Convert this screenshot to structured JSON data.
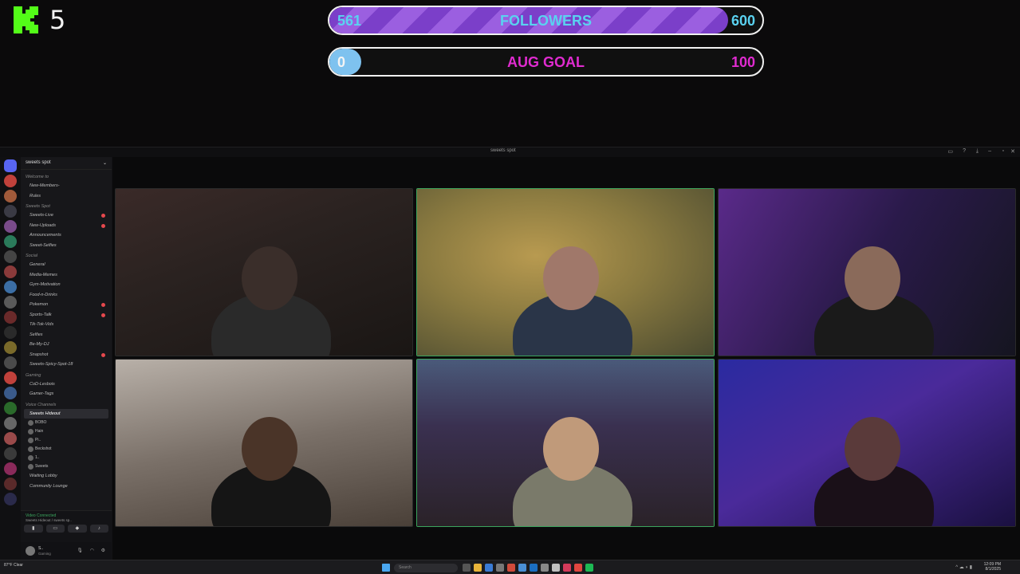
{
  "overlay": {
    "kick_count": "5",
    "followers_bar": {
      "current": "561",
      "label": "FOLLOWERS",
      "goal": "600",
      "fraction": 0.92
    },
    "aug_goal_bar": {
      "current": "0",
      "label": "AUG GOAL",
      "goal": "100",
      "fraction": 0.0
    }
  },
  "discord": {
    "window_title": "sweets spot",
    "server_name": "sweets spot",
    "categories": [
      {
        "name": "Welcome to",
        "channels": [
          {
            "label": "New-Members-",
            "unread": false
          },
          {
            "label": "Rules",
            "unread": false
          }
        ]
      },
      {
        "name": "Sweets Spot",
        "channels": [
          {
            "label": "Sweets-Live",
            "unread": true
          },
          {
            "label": "New-Uploads",
            "unread": true
          },
          {
            "label": "Announcements",
            "unread": false
          },
          {
            "label": "Sweet-Selfies",
            "unread": false
          }
        ]
      },
      {
        "name": "Social",
        "channels": [
          {
            "label": "General",
            "unread": false
          },
          {
            "label": "Media-Memes",
            "unread": false
          },
          {
            "label": "Gym-Motivation",
            "unread": false
          },
          {
            "label": "Food-n-Drinks",
            "unread": false
          },
          {
            "label": "Pokemon",
            "unread": true
          },
          {
            "label": "Sports-Talk",
            "unread": true
          },
          {
            "label": "Tik-Tok-Vids",
            "unread": false
          },
          {
            "label": "Selfies",
            "unread": false
          },
          {
            "label": "Be-My-DJ",
            "unread": false
          },
          {
            "label": "Snapshot",
            "unread": true
          },
          {
            "label": "Sweets-Spicy-Spot-18",
            "unread": false
          }
        ]
      },
      {
        "name": "Gaming",
        "channels": [
          {
            "label": "CoD-Lesbois",
            "unread": false
          },
          {
            "label": "Gamer-Tags",
            "unread": false
          }
        ]
      }
    ],
    "voice_category": "Voice Channels",
    "voice_channel": "Sweets Hideout",
    "voice_users": [
      "BOBO",
      "Hain",
      "Pi..",
      "Beckshot",
      "1..",
      "Sweets"
    ],
    "other_voice": [
      "Waiting Lobby",
      "Community Lounge"
    ],
    "vc_status_title": "Video Connected",
    "vc_status_sub": "Sweets Hideout / sweets sp..",
    "user_name": "S..",
    "user_status": "Gaming",
    "tiles": [
      {
        "name": ""
      },
      {
        "name": ""
      },
      {
        "name": ""
      },
      {
        "name": ""
      },
      {
        "name": ""
      },
      {
        "name": ""
      }
    ]
  },
  "taskbar": {
    "weather": "87°F Clear",
    "search_placeholder": "Search",
    "time": "12:09 PM",
    "date": "8/1/2025"
  }
}
